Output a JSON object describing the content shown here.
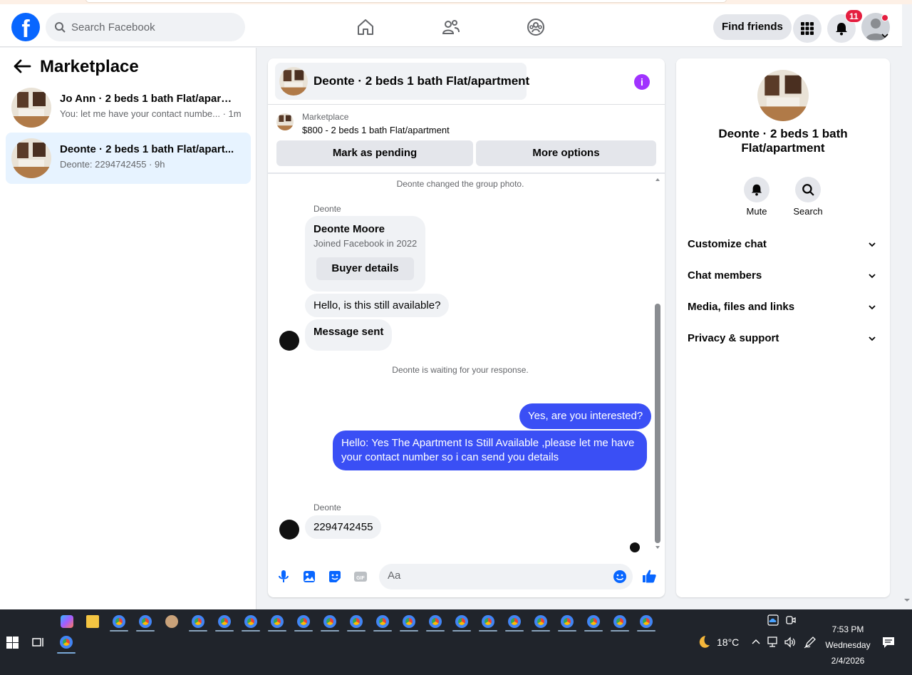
{
  "header": {
    "search_placeholder": "Search Facebook",
    "find_friends_label": "Find friends",
    "notifications_count": "11",
    "brand_color": "#0866ff"
  },
  "sidebar": {
    "title": "Marketplace",
    "conversations": [
      {
        "name": "Jo Ann · 2 beds 1 bath Flat/apartm...",
        "preview": "You: let me have your contact numbe... · 1m",
        "active": false
      },
      {
        "name": "Deonte · 2 beds 1 bath Flat/apart...",
        "preview": "Deonte: 2294742455 · 9h",
        "active": true
      }
    ]
  },
  "chat": {
    "title": "Deonte · 2 beds 1 bath Flat/apartment",
    "marketplace_label": "Marketplace",
    "listing": "$800 - 2 beds 1 bath Flat/apartment",
    "mark_pending_label": "Mark as pending",
    "more_options_label": "More options",
    "system_group_photo": "Deonte changed the group photo.",
    "sender_name": "Deonte",
    "buyer_card": {
      "name": "Deonte Moore",
      "joined": "Joined Facebook in 2022",
      "button": "Buyer details"
    },
    "messages_in_1": "Hello, is this still available?",
    "messages_in_2": "Message sent",
    "system_waiting": "Deonte is waiting for your response.",
    "messages_out_1": "Yes, are you interested?",
    "messages_out_2": "Hello: Yes The Apartment Is Still Available ,please let me have your contact number so i can send you details",
    "sender_name_2": "Deonte",
    "messages_in_3": "2294742455",
    "composer_placeholder": "Aa",
    "outgoing_color": "#3a4ff5"
  },
  "details": {
    "title": "Deonte · 2 beds 1 bath Flat/apartment",
    "mute_label": "Mute",
    "search_label": "Search",
    "rows": [
      "Customize chat",
      "Chat members",
      "Media, files and links",
      "Privacy & support"
    ]
  },
  "taskbar": {
    "temperature": "18°C",
    "time": "7:53 PM",
    "day": "Wednesday",
    "date": "2/4/2026"
  }
}
